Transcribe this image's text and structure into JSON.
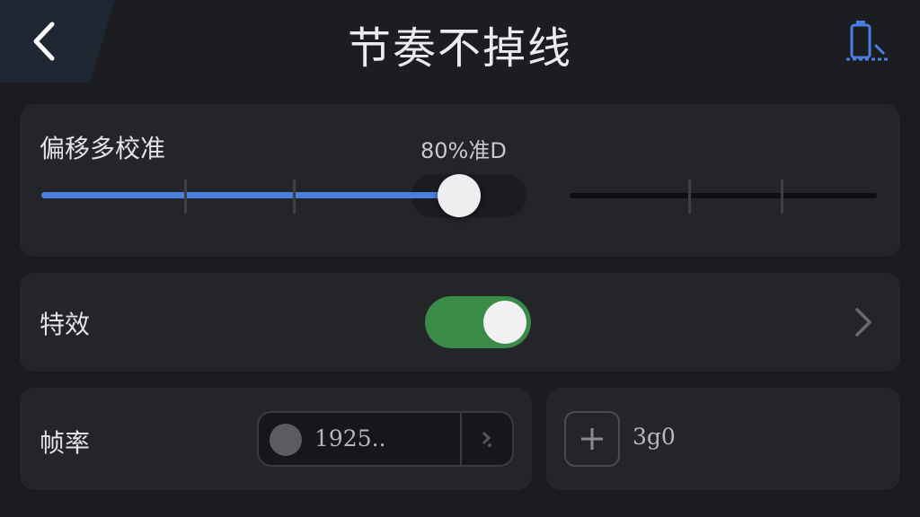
{
  "header": {
    "title": "节奏不掉线",
    "back_icon": "chevron-left-icon",
    "device_icon": "battery-phone-icon",
    "accent": "#4a7fe0"
  },
  "offset_card": {
    "label": "偏移多校准",
    "value_text": "80%准D",
    "slider_fraction": 0.5
  },
  "effects_card": {
    "label": "特效",
    "toggle_on": true,
    "toggle_color": "#3a8a48"
  },
  "fps_card": {
    "label": "帧率",
    "value": "1925.."
  },
  "add_card": {
    "count": "3g0"
  }
}
